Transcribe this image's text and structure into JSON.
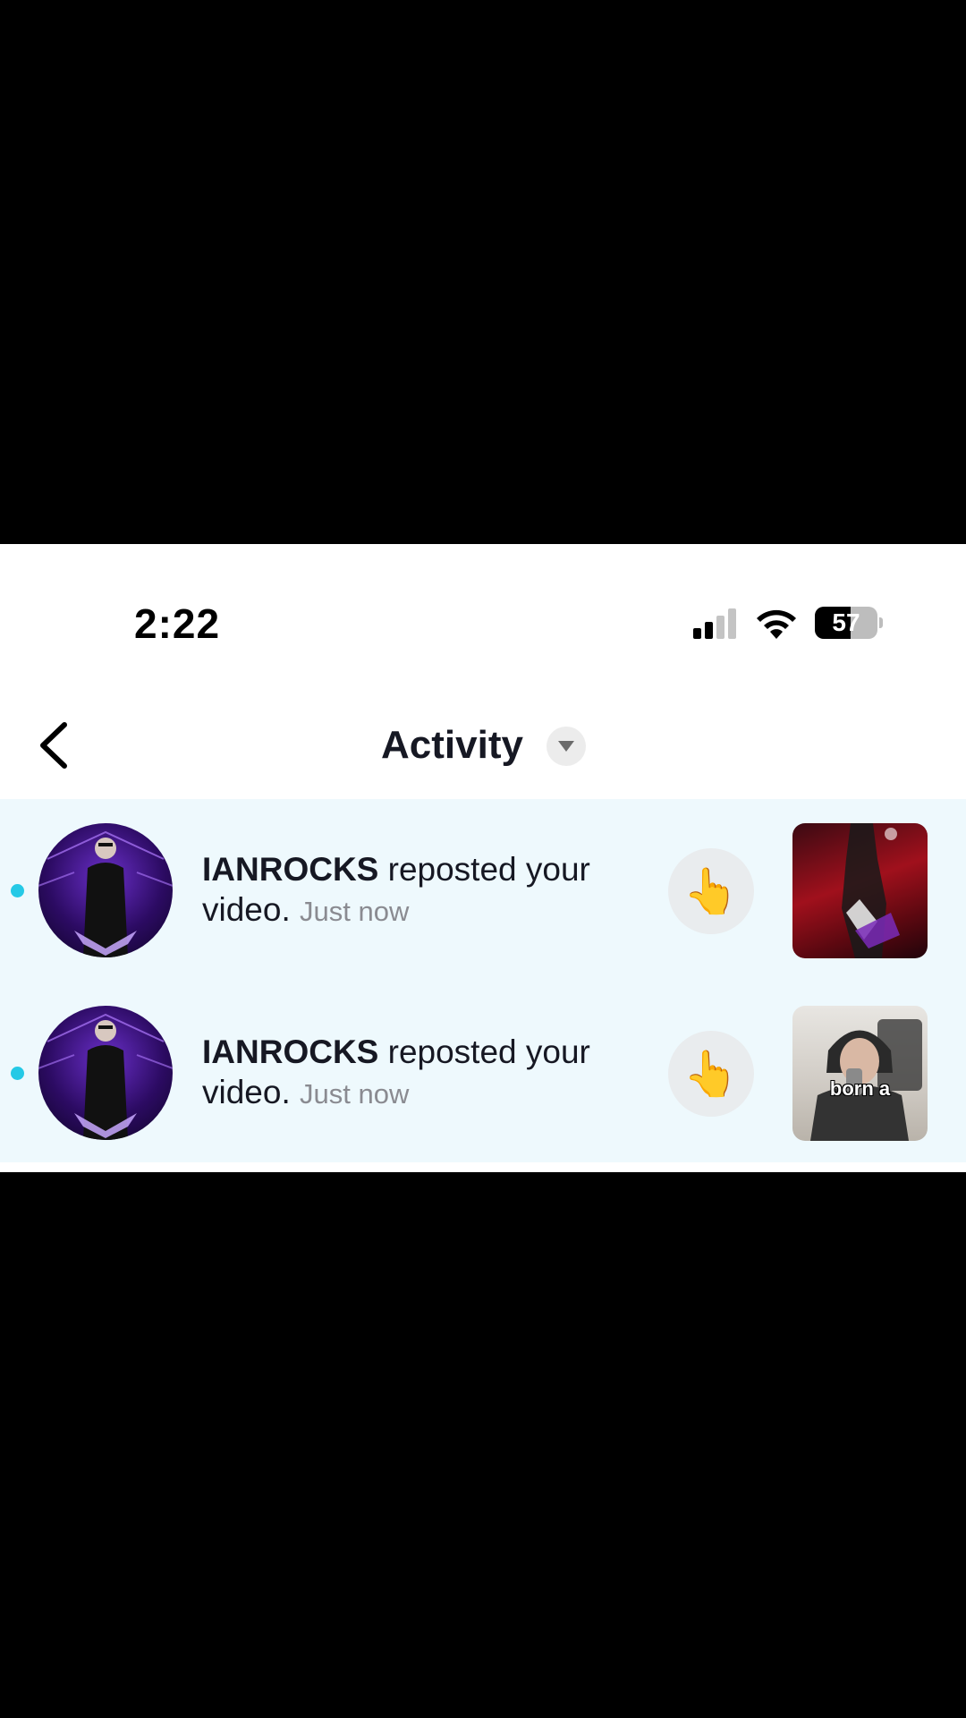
{
  "status_bar": {
    "time": "2:22",
    "battery_level": "57",
    "battery_fraction": 0.57,
    "signal_icon": "cellular-signal-icon",
    "wifi_icon": "wifi-icon"
  },
  "header": {
    "back_icon": "chevron-left-icon",
    "title": "Activity",
    "dropdown_icon": "caret-down-icon"
  },
  "activities": [
    {
      "username": "IANROCKS",
      "action": " reposted your video.",
      "time": "Just now",
      "reaction_emoji": "👆",
      "thumbnail_caption": ""
    },
    {
      "username": "IANROCKS",
      "action": " reposted your video.",
      "time": "Just now",
      "reaction_emoji": "👆",
      "thumbnail_caption": "born a"
    }
  ],
  "colors": {
    "accent_unread": "#25c9e6",
    "list_background": "#eef9fd",
    "text_primary": "#161823",
    "text_secondary": "#8a8b91"
  }
}
